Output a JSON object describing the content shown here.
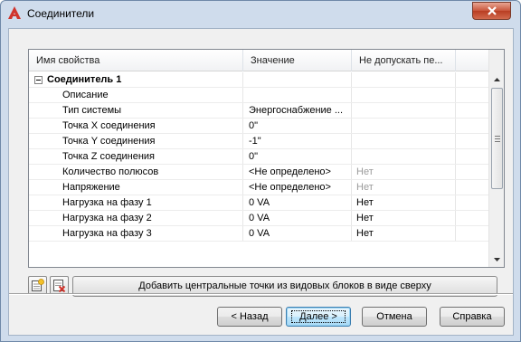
{
  "window": {
    "title": "Соединители",
    "close_label": "✕"
  },
  "grid": {
    "columns": [
      "Имя свойства",
      "Значение",
      "Не допускать пе...",
      ""
    ],
    "group": {
      "label": "Соединитель 1",
      "expanded": true
    },
    "rows": [
      {
        "name": "Описание",
        "value": "",
        "flag": "",
        "flag_dim": false
      },
      {
        "name": "Тип системы",
        "value": "Энергоснабжение ...",
        "flag": "",
        "flag_dim": false
      },
      {
        "name": "Точка X соединения",
        "value": "0\"",
        "flag": "",
        "flag_dim": false
      },
      {
        "name": "Точка Y соединения",
        "value": "-1\"",
        "flag": "",
        "flag_dim": false
      },
      {
        "name": "Точка Z соединения",
        "value": "0\"",
        "flag": "",
        "flag_dim": false
      },
      {
        "name": "Количество полюсов",
        "value": "<Не определено>",
        "flag": "Нет",
        "flag_dim": true
      },
      {
        "name": "Напряжение",
        "value": "<Не определено>",
        "flag": "Нет",
        "flag_dim": true
      },
      {
        "name": "Нагрузка на фазу 1",
        "value": "0 VA",
        "flag": "Нет",
        "flag_dim": false
      },
      {
        "name": "Нагрузка на фазу 2",
        "value": "0 VA",
        "flag": "Нет",
        "flag_dim": false
      },
      {
        "name": "Нагрузка на фазу 3",
        "value": "0 VA",
        "flag": "Нет",
        "flag_dim": false
      }
    ]
  },
  "toolbar": {
    "add_icon": "add-connector-icon",
    "delete_icon": "delete-connector-icon",
    "add_center_points_label": "Добавить центральные точки из видовых блоков в виде сверху"
  },
  "footer": {
    "back_label": "< Назад",
    "next_label": "Далее >",
    "cancel_label": "Отмена",
    "help_label": "Справка"
  },
  "colors": {
    "brand_red": "#d0342c",
    "default_button_border": "#3c7fb1",
    "dim_text": "#9b9b9b"
  }
}
